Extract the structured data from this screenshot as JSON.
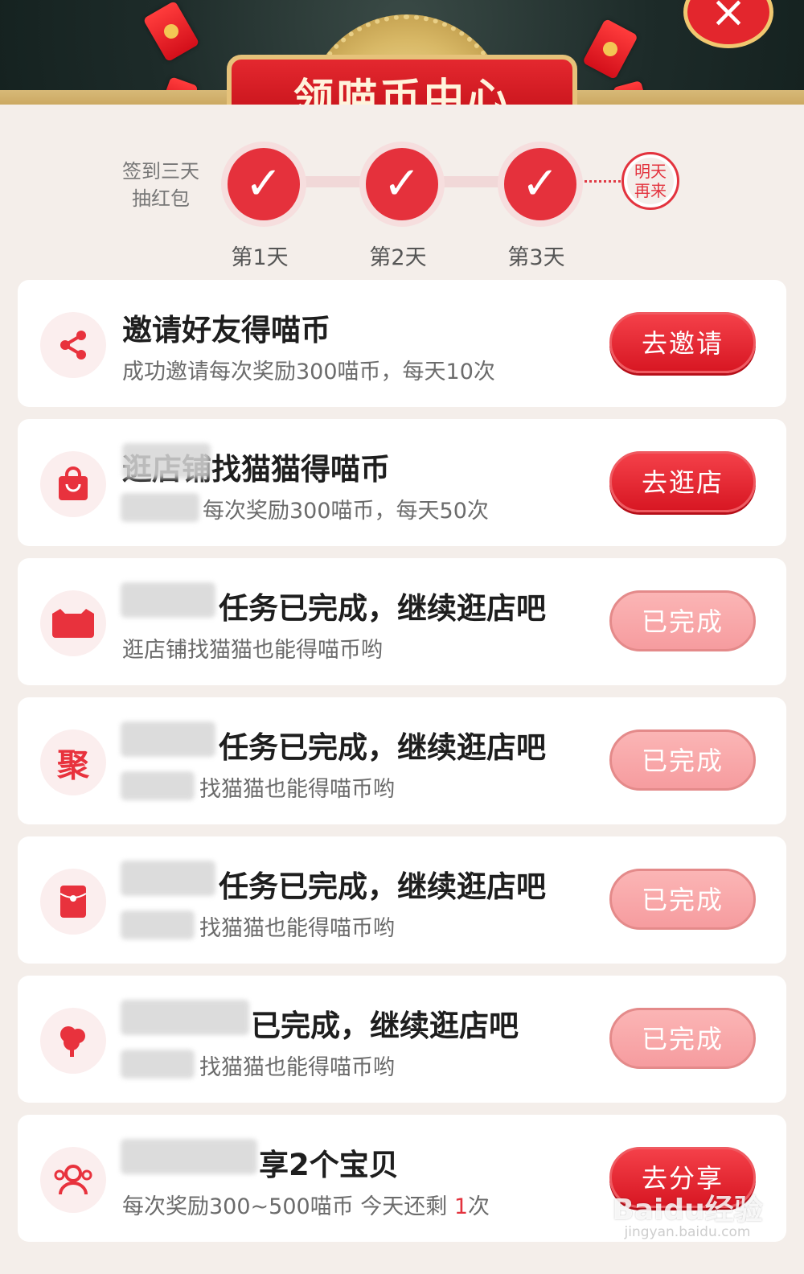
{
  "header": {
    "title": "领喵币中心",
    "close_icon": "×"
  },
  "signin": {
    "label_line1": "签到三天",
    "label_line2": "抽红包",
    "days": [
      {
        "label": "第1天",
        "icon": "✓"
      },
      {
        "label": "第2天",
        "icon": "✓"
      },
      {
        "label": "第3天",
        "icon": "✓"
      }
    ],
    "tomorrow_line1": "明天",
    "tomorrow_line2": "再来"
  },
  "tasks": [
    {
      "icon": "share-icon",
      "title": "邀请好友得喵币",
      "desc": "成功邀请每次奖励300喵币，每天10次",
      "button": "去邀请",
      "state": "go"
    },
    {
      "icon": "shopping-bag-icon",
      "title": "逛店铺找猫猫得喵币",
      "desc": "每次奖励300喵币，每天50次",
      "button": "去逛店",
      "state": "go"
    },
    {
      "icon": "tmall-icon",
      "title": "任务已完成，继续逛店吧",
      "desc": "逛店铺找猫猫也能得喵币哟",
      "button": "已完成",
      "state": "done"
    },
    {
      "icon": "ju-icon",
      "icon_text": "聚",
      "title": "任务已完成，继续逛店吧",
      "desc": "找猫猫也能得喵币哟",
      "button": "已完成",
      "state": "done"
    },
    {
      "icon": "red-packet-icon",
      "title": "任务已完成，继续逛店吧",
      "desc": "找猫猫也能得喵币哟",
      "button": "已完成",
      "state": "done"
    },
    {
      "icon": "tree-icon",
      "title": "已完成，继续逛店吧",
      "desc": "找猫猫也能得喵币哟",
      "button": "已完成",
      "state": "done"
    },
    {
      "icon": "group-icon",
      "title": "享2个宝贝",
      "desc_prefix": "每次奖励300~500喵币 今天还剩 ",
      "desc_count": "1",
      "desc_suffix": "次",
      "button": "去分享",
      "state": "go"
    }
  ],
  "watermark": {
    "text": "Baidu经验",
    "sub": "jingyan.baidu.com"
  },
  "colors": {
    "accent": "#e5313c",
    "done": "#f69c9f",
    "header_bg": "#1d2b29",
    "gold": "#d7b978"
  }
}
